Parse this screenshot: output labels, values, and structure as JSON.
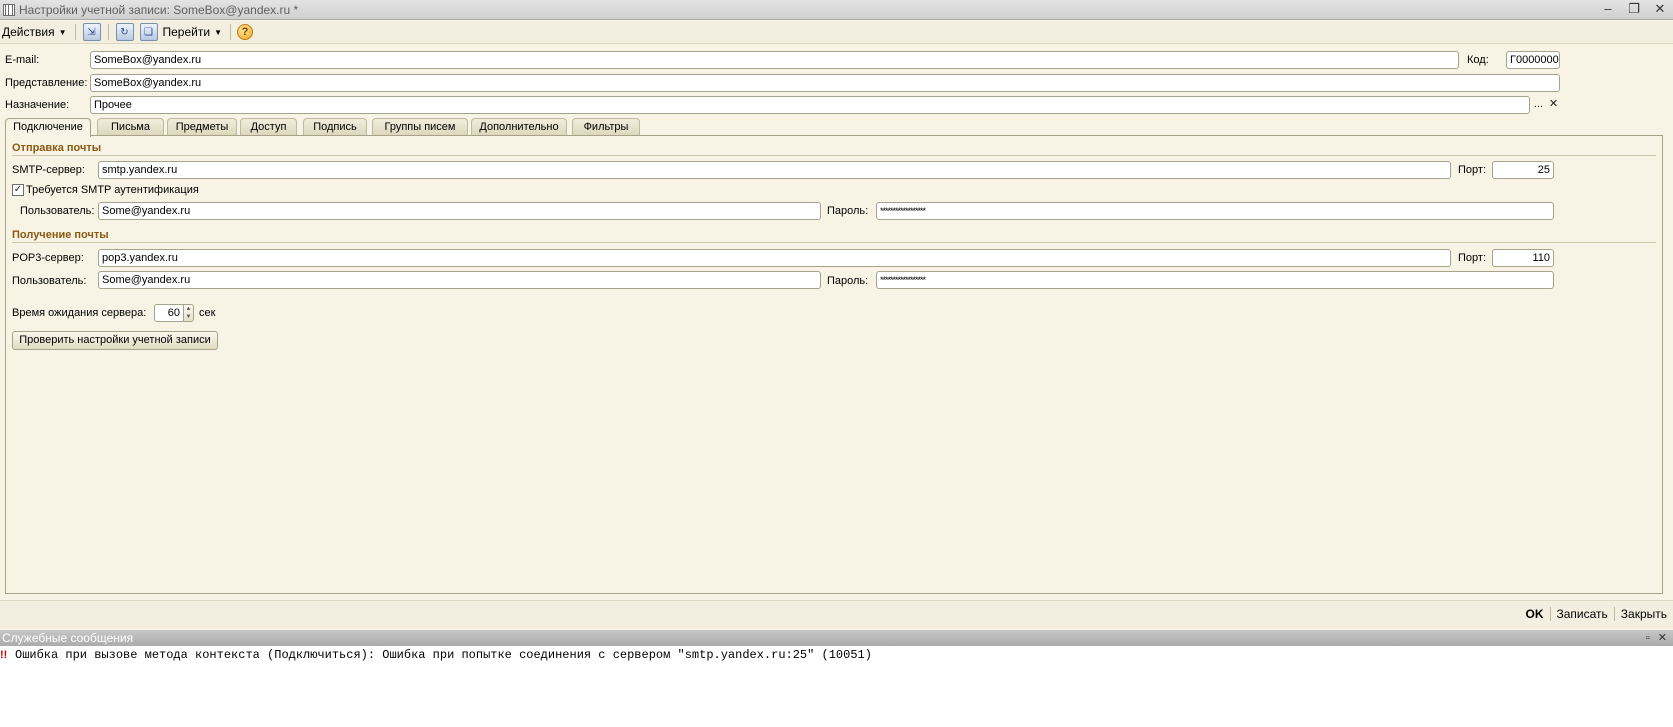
{
  "window": {
    "title": "Настройки учетной записи: SomeBox@yandex.ru *"
  },
  "toolbar": {
    "actions_label": "Действия",
    "goto_label": "Перейти",
    "help_label": "?"
  },
  "header_fields": {
    "email_label": "E-mail:",
    "email_value": "SomeBox@yandex.ru",
    "code_label": "Код:",
    "code_value": "Г0000000",
    "presentation_label": "Представление:",
    "presentation_value": "SomeBox@yandex.ru",
    "purpose_label": "Назначение:",
    "purpose_value": "Прочее",
    "choose_glyph": "...",
    "clear_glyph": "✕"
  },
  "tabs": [
    {
      "label": "Подключение",
      "active": true
    },
    {
      "label": "Письма"
    },
    {
      "label": "Предметы"
    },
    {
      "label": "Доступ"
    },
    {
      "label": "Подпись"
    },
    {
      "label": "Группы писем"
    },
    {
      "label": "Дополнительно"
    },
    {
      "label": "Фильтры"
    }
  ],
  "sending": {
    "section_title": "Отправка почты",
    "smtp_label": "SMTP-сервер:",
    "smtp_value": "smtp.yandex.ru",
    "port_label": "Порт:",
    "port_value": "25",
    "auth_label": "Требуется SMTP аутентификация",
    "auth_checked": true,
    "user_label": "Пользователь:",
    "user_value": "Some@yandex.ru",
    "password_label": "Пароль:",
    "password_value": "******************"
  },
  "receiving": {
    "section_title": "Получение почты",
    "pop3_label": "POP3-сервер:",
    "pop3_value": "pop3.yandex.ru",
    "port_label": "Порт:",
    "port_value": "110",
    "user_label": "Пользователь:",
    "user_value": "Some@yandex.ru",
    "password_label": "Пароль:",
    "password_value": "******************"
  },
  "timeout": {
    "label": "Время ожидания сервера:",
    "value": "60",
    "unit": "сек"
  },
  "check_button_label": "Проверить настройки учетной записи",
  "bottom_actions": {
    "ok": "OK",
    "save": "Записать",
    "close": "Закрыть"
  },
  "messages": {
    "title": "Служебные сообщения",
    "items": [
      {
        "marker": "!!",
        "text": "Ошибка при вызове метода контекста (Подключиться): Ошибка при попытке соединения с сервером \"smtp.yandex.ru:25\" (10051)"
      }
    ]
  }
}
